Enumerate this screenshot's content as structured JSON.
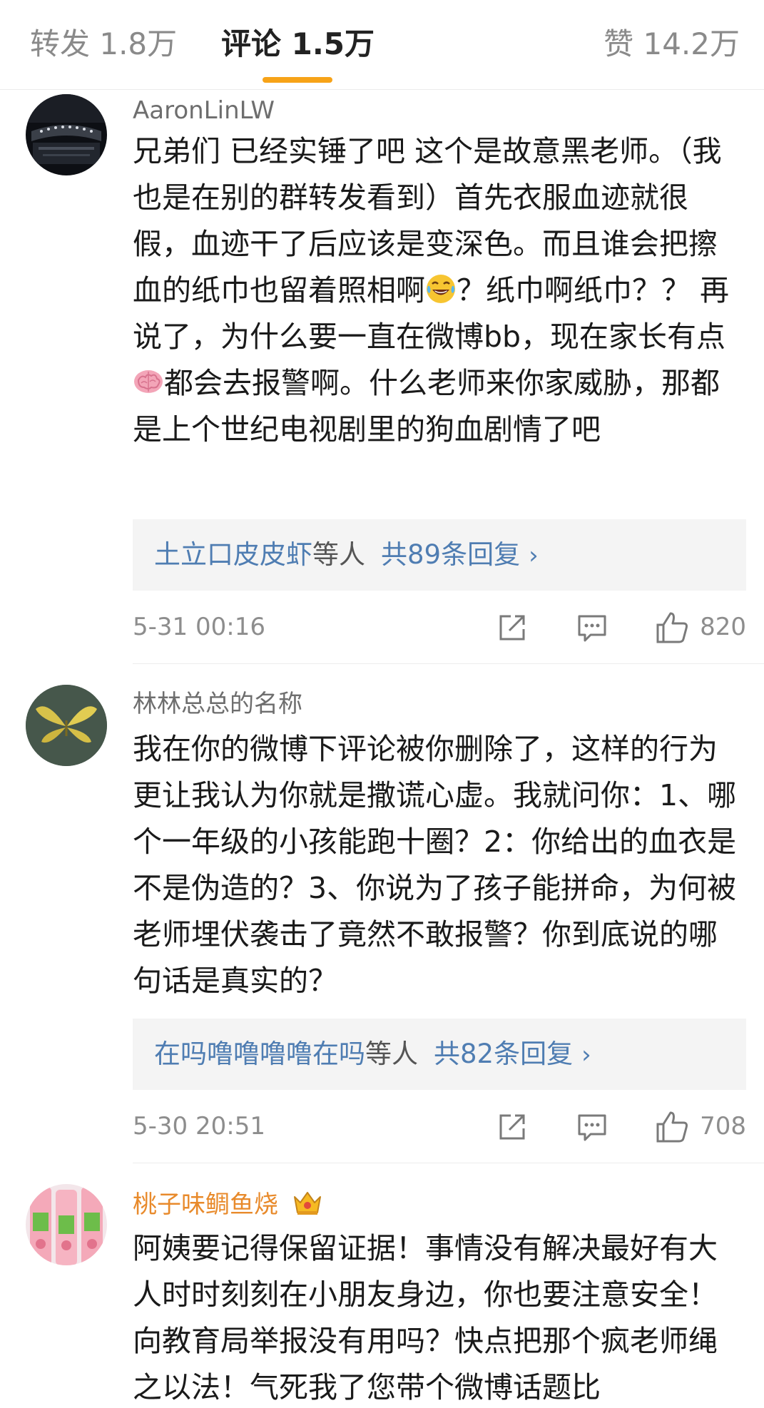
{
  "tabs": {
    "repost": "转发 1.8万",
    "comments": "评论 1.5万",
    "likes": "赞 14.2万",
    "accent_color": "#f7a318"
  },
  "comments": [
    {
      "user": "AaronLinLW",
      "text_parts": [
        "兄弟们 已经实锤了吧 这个是故意黑老师。（我也是在别的群转发看到）首先衣服血迹就很假，血迹干了后应该是变深色。而且谁会把擦血的纸巾也留着照相啊",
        "？纸巾啊纸巾？？ 再说了，为什么要一直在微博bb，现在家长有点",
        "都会去报警啊。什么老师来你家威胁，那都是上个世纪电视剧里的狗血剧情了吧"
      ],
      "emoji_1": "laughing-tears-emoji",
      "emoji_2": "brain-emoji",
      "replies_who": "土立口皮皮虾",
      "replies_etc": "等人",
      "replies_count": "共89条回复",
      "replies_chevron": "›",
      "time": "5-31 00:16",
      "likes": "820"
    },
    {
      "user": "林林总总的名称",
      "text": "我在你的微博下评论被你删除了，这样的行为更让我认为你就是撒谎心虚。我就问你：1、哪个一年级的小孩能跑十圈？2：你给出的血衣是不是伪造的？3、你说为了孩子能拼命，为何被老师埋伏袭击了竟然不敢报警？你到底说的哪句话是真实的？",
      "replies_who": "在吗噜噜噜噜在吗",
      "replies_etc": "等人",
      "replies_count": "共82条回复",
      "replies_chevron": "›",
      "time": "5-30 20:51",
      "likes": "708"
    },
    {
      "user": "桃子味鲷鱼烧",
      "badge": "crown-badge-icon",
      "text": "阿姨要记得保留证据！事情没有解决最好有大人时时刻刻在小朋友身边，你也要注意安全！向教育局举报没有用吗？快点把那个疯老师绳之以法！气死我了您带个微博话题比"
    }
  ],
  "colors": {
    "link": "#4f7db2",
    "vip_name": "#e88a2b",
    "meta": "#8d8d8d"
  }
}
